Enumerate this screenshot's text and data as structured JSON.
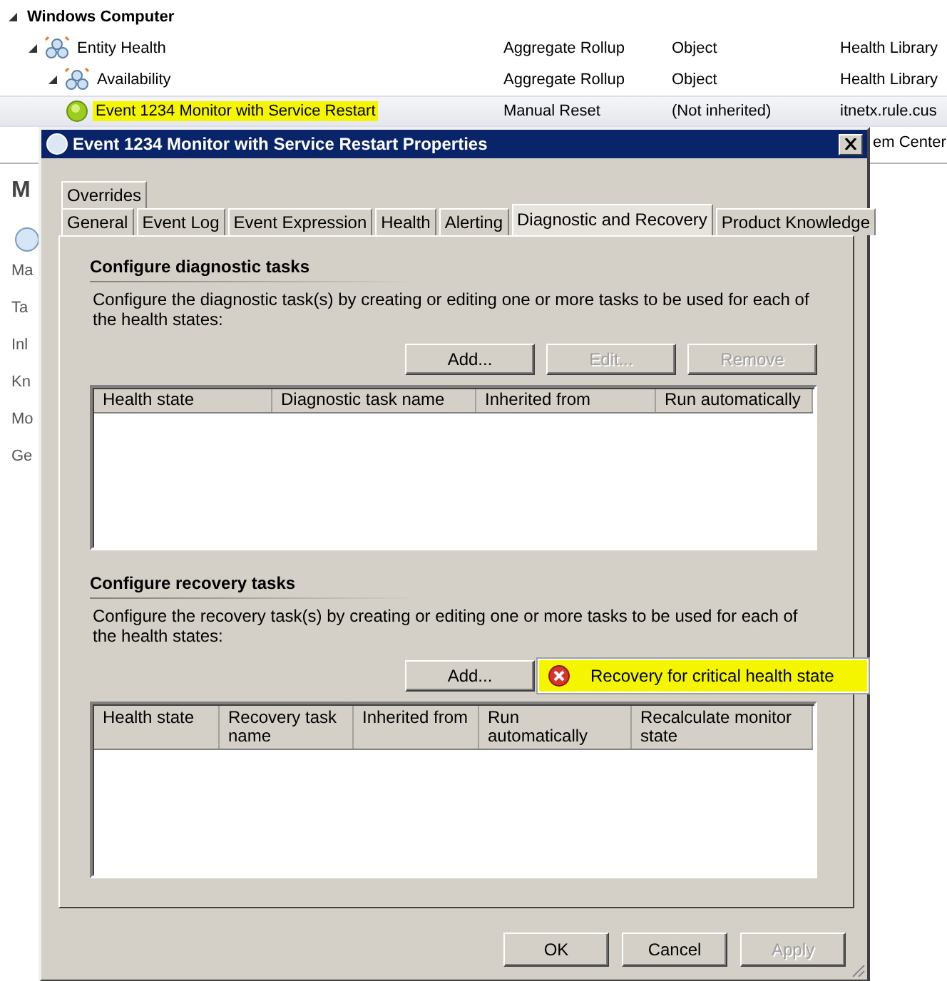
{
  "tree": {
    "rows": [
      {
        "name": "Windows Computer",
        "kind": "root",
        "expanded": true,
        "selected": false,
        "highlighted": false,
        "children": [
          {
            "name": "Entity Health",
            "kind": "aggregate",
            "expanded": true,
            "selected": false,
            "highlighted": false,
            "columns": [
              "Aggregate Rollup",
              "Object",
              "Health Library"
            ],
            "children": [
              {
                "name": "Availability",
                "kind": "aggregate",
                "expanded": true,
                "selected": false,
                "highlighted": false,
                "columns": [
                  "Aggregate Rollup",
                  "Object",
                  "Health Library"
                ],
                "children": [
                  {
                    "name": "Event 1234 Monitor with Service Restart",
                    "kind": "monitor",
                    "selected": true,
                    "highlighted": true,
                    "columns": [
                      "Manual Reset",
                      "(Not inherited)",
                      "itnetx.rule.cus"
                    ]
                  }
                ]
              }
            ]
          }
        ]
      }
    ],
    "hidden_row_fragment": "em Center"
  },
  "details_panel": {
    "heading": "M",
    "labels": [
      "Ma",
      "Ta",
      "Inl",
      "Kn",
      "Mo",
      "Ge"
    ]
  },
  "dialog": {
    "title": "Event 1234 Monitor with Service Restart Properties",
    "tab_rows": [
      [
        {
          "label": "Overrides",
          "selected": false
        }
      ],
      [
        {
          "label": "General",
          "selected": false
        },
        {
          "label": "Event Log",
          "selected": false
        },
        {
          "label": "Event Expression",
          "selected": false
        },
        {
          "label": "Health",
          "selected": false
        },
        {
          "label": "Alerting",
          "selected": false
        },
        {
          "label": "Diagnostic and Recovery",
          "selected": true
        },
        {
          "label": "Product Knowledge",
          "selected": false
        }
      ]
    ],
    "diagnostic": {
      "heading": "Configure diagnostic tasks",
      "description": "Configure the diagnostic task(s) by creating or editing one or more tasks to be used for each of the health states:",
      "buttons": [
        {
          "label": "Add...",
          "disabled": false
        },
        {
          "label": "Edit...",
          "disabled": true
        },
        {
          "label": "Remove",
          "disabled": true
        }
      ],
      "columns": [
        "Health state",
        "Diagnostic task name",
        "Inherited from",
        "Run automatically"
      ]
    },
    "recovery": {
      "heading": "Configure recovery tasks",
      "description": "Configure the recovery task(s) by creating or editing one or more tasks to be used for each of the health states:",
      "buttons": [
        {
          "label": "Add...",
          "disabled": false
        }
      ],
      "menu": [
        {
          "label": "Recovery for critical health state",
          "highlighted": true
        }
      ],
      "columns": [
        "Health state",
        "Recovery task name",
        "Inherited from",
        "Run automatically",
        "Recalculate monitor state"
      ]
    },
    "footer_buttons": [
      {
        "label": "OK",
        "disabled": false
      },
      {
        "label": "Cancel",
        "disabled": false
      },
      {
        "label": "Apply",
        "disabled": true
      }
    ]
  }
}
